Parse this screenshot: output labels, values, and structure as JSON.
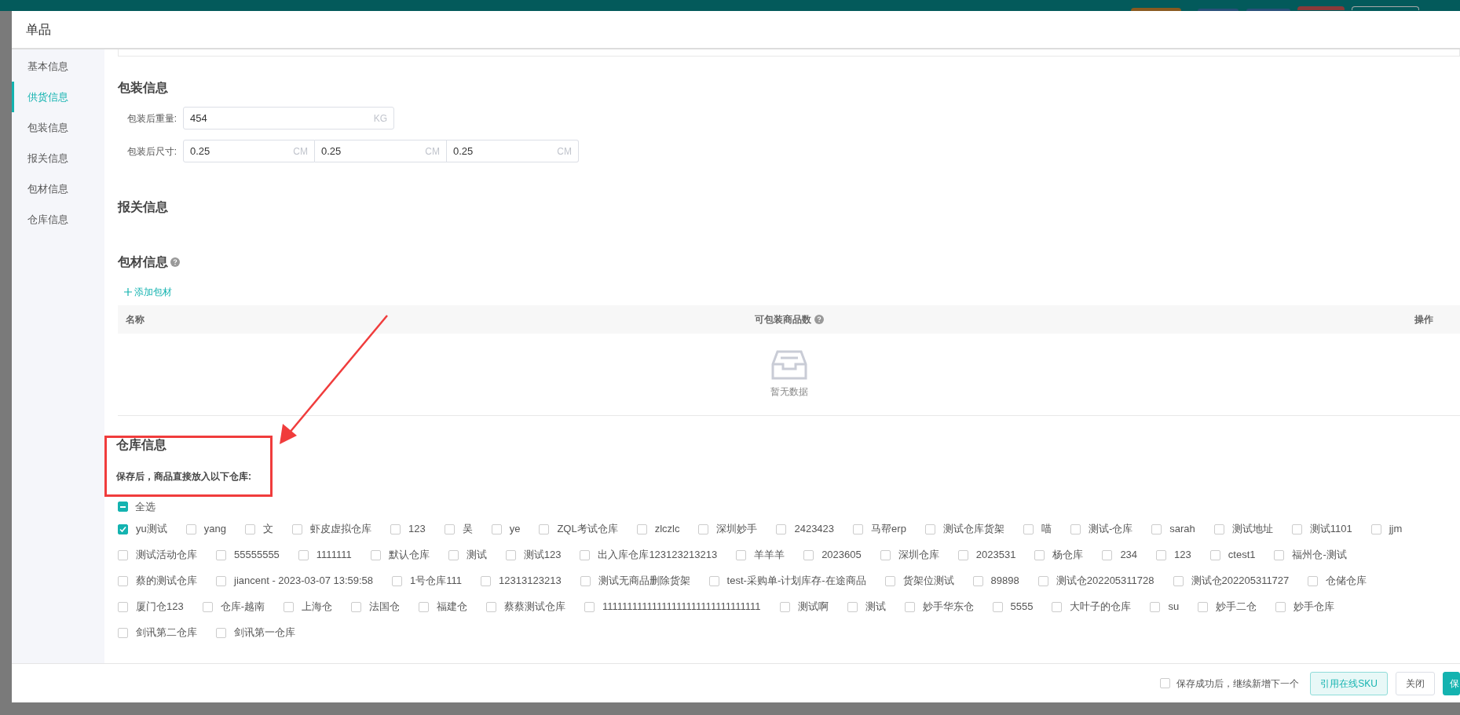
{
  "dialog": {
    "title": "单品"
  },
  "nav": [
    {
      "label": "基本信息",
      "selected": false
    },
    {
      "label": "供货信息",
      "selected": true
    },
    {
      "label": "包装信息",
      "selected": false
    },
    {
      "label": "报关信息",
      "selected": false
    },
    {
      "label": "包材信息",
      "selected": false
    },
    {
      "label": "仓库信息",
      "selected": false
    }
  ],
  "packaging": {
    "title": "包装信息",
    "weight": {
      "label": "包装后重量:",
      "value": "454",
      "unit": "KG"
    },
    "size": {
      "label": "包装后尺寸:",
      "fields": [
        {
          "value": "0.25",
          "unit": "CM"
        },
        {
          "value": "0.25",
          "unit": "CM"
        },
        {
          "value": "0.25",
          "unit": "CM"
        }
      ]
    }
  },
  "customs": {
    "title": "报关信息"
  },
  "materials": {
    "title": "包材信息",
    "add_button": "添加包材",
    "table": {
      "columns": [
        "名称",
        "可包装商品数",
        "操作"
      ],
      "empty_text": "暂无数据"
    }
  },
  "warehouse": {
    "title": "仓库信息",
    "note": "保存后，商品直接放入以下仓库:",
    "select_all": {
      "label": "全选",
      "indeterminate": true
    },
    "groups": [
      {
        "options": [
          {
            "name": "yu测试",
            "checked": true
          },
          {
            "name": "yang",
            "checked": false
          },
          {
            "name": "文",
            "checked": false
          },
          {
            "name": "虾皮虚拟仓库",
            "checked": false
          },
          {
            "name": "123",
            "checked": false
          },
          {
            "name": "吴",
            "checked": false
          },
          {
            "name": "ye",
            "checked": false
          },
          {
            "name": "ZQL考试仓库",
            "checked": false
          },
          {
            "name": "zlczlc",
            "checked": false
          },
          {
            "name": "深圳妙手",
            "checked": false
          },
          {
            "name": "2423423",
            "checked": false
          },
          {
            "name": "马帮erp",
            "checked": false
          },
          {
            "name": "测试仓库货架",
            "checked": false
          },
          {
            "name": "喵",
            "checked": false
          },
          {
            "name": "测试-仓库",
            "checked": false
          },
          {
            "name": "sarah",
            "checked": false
          },
          {
            "name": "测试地址",
            "checked": false
          },
          {
            "name": "测试1101",
            "checked": false
          },
          {
            "name": "jjm",
            "checked": false
          }
        ]
      },
      {
        "options": [
          {
            "name": "测试活动仓库",
            "checked": false
          },
          {
            "name": "55555555",
            "checked": false
          },
          {
            "name": "1111111",
            "checked": false
          },
          {
            "name": "默认仓库",
            "checked": false
          },
          {
            "name": "测试",
            "checked": false
          },
          {
            "name": "测试123",
            "checked": false
          },
          {
            "name": "出入库仓库123123213213",
            "checked": false
          },
          {
            "name": "羊羊羊",
            "checked": false
          },
          {
            "name": "2023605",
            "checked": false
          },
          {
            "name": "深圳仓库",
            "checked": false
          },
          {
            "name": "2023531",
            "checked": false
          },
          {
            "name": "杨仓库",
            "checked": false
          },
          {
            "name": "234",
            "checked": false
          },
          {
            "name": "123",
            "checked": false
          },
          {
            "name": "ctest1",
            "checked": false
          },
          {
            "name": "福州仓-测试",
            "checked": false
          }
        ]
      },
      {
        "options": [
          {
            "name": "蔡的测试仓库",
            "checked": false
          },
          {
            "name": "jiancent - 2023-03-07 13:59:58",
            "checked": false
          },
          {
            "name": "1号仓库111",
            "checked": false
          },
          {
            "name": "12313123213",
            "checked": false
          },
          {
            "name": "测试无商品删除货架",
            "checked": false
          },
          {
            "name": "test-采购单-计划库存-在途商品",
            "checked": false
          },
          {
            "name": "货架位测试",
            "checked": false
          },
          {
            "name": "89898",
            "checked": false
          },
          {
            "name": "测试仓202205311728",
            "checked": false
          },
          {
            "name": "测试仓202205311727",
            "checked": false
          },
          {
            "name": "仓储仓库",
            "checked": false
          }
        ]
      },
      {
        "options": [
          {
            "name": "厦门仓123",
            "checked": false
          },
          {
            "name": "仓库-越南",
            "checked": false
          },
          {
            "name": "上海仓",
            "checked": false
          },
          {
            "name": "法国仓",
            "checked": false
          },
          {
            "name": "福建仓",
            "checked": false
          },
          {
            "name": "蔡蔡测试仓库",
            "checked": false
          },
          {
            "name": "11111111111111111111111111111111",
            "checked": false
          },
          {
            "name": "测试啊",
            "checked": false
          },
          {
            "name": "测试",
            "checked": false
          },
          {
            "name": "妙手华东仓",
            "checked": false
          },
          {
            "name": "5555",
            "checked": false
          },
          {
            "name": "大叶子的仓库",
            "checked": false
          },
          {
            "name": "su",
            "checked": false
          },
          {
            "name": "妙手二仓",
            "checked": false
          },
          {
            "name": "妙手仓库",
            "checked": false
          }
        ]
      },
      {
        "options": [
          {
            "name": "剑讯第二仓库",
            "checked": false
          },
          {
            "name": "剑讯第一仓库",
            "checked": false
          }
        ]
      }
    ]
  },
  "footer": {
    "continue_option": {
      "label": "保存成功后，继续新增下一个",
      "checked": false
    },
    "buttons": [
      {
        "label": "引用在线SKU",
        "kind": "secondary"
      },
      {
        "label": "关闭",
        "kind": "default"
      },
      {
        "label": "保",
        "kind": "primary"
      }
    ]
  }
}
